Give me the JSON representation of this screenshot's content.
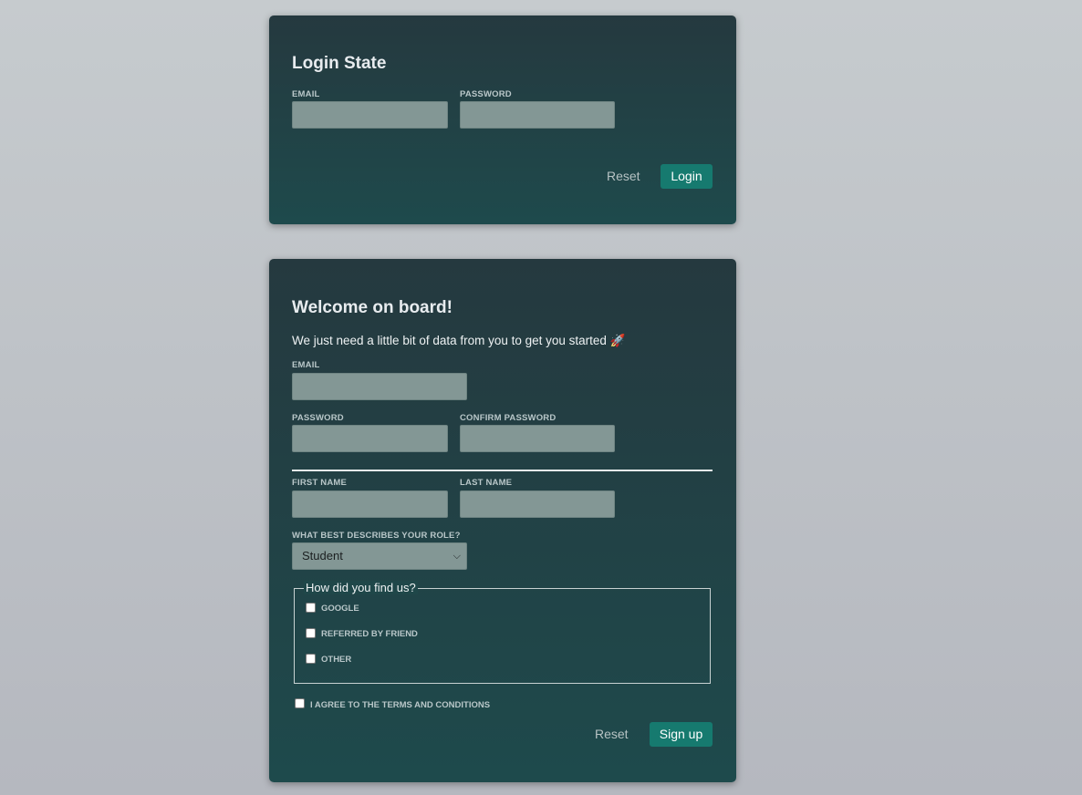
{
  "login": {
    "title": "Login State",
    "email_label": "EMAIL",
    "password_label": "PASSWORD",
    "email_value": "",
    "password_value": "",
    "reset_label": "Reset",
    "submit_label": "Login"
  },
  "signup": {
    "title": "Welcome on board!",
    "subtitle": "We just need a little bit of data from you to get you started 🚀",
    "email_label": "EMAIL",
    "password_label": "PASSWORD",
    "confirm_password_label": "CONFIRM PASSWORD",
    "first_name_label": "FIRST NAME",
    "last_name_label": "LAST NAME",
    "role_label": "WHAT BEST DESCRIBES YOUR ROLE?",
    "role_selected": "Student",
    "source_legend": "How did you find us?",
    "source_options": [
      "GOOGLE",
      "REFERRED BY FRIEND",
      "OTHER"
    ],
    "terms_label": "I AGREE TO THE TERMS AND CONDITIONS",
    "reset_label": "Reset",
    "submit_label": "Sign up"
  },
  "colors": {
    "card_bg": "#1f4547",
    "input_bg": "#839795",
    "primary_button": "#167a6f"
  }
}
